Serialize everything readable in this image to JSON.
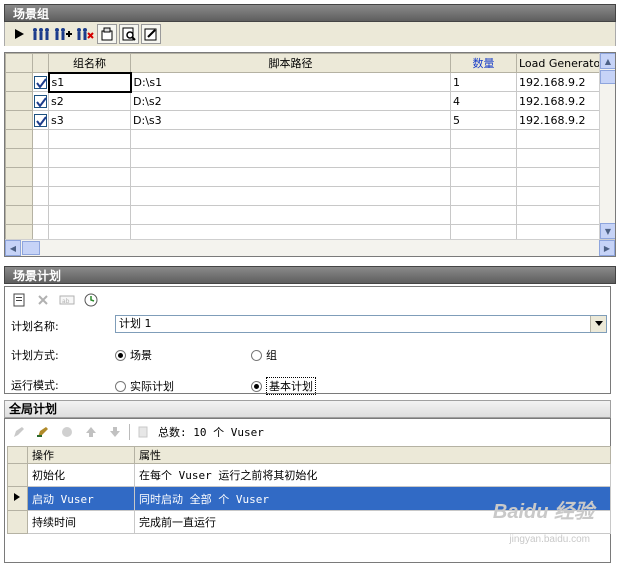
{
  "scenario_groups": {
    "title": "场景组",
    "toolbar": [
      "play-icon",
      "vusers-icon",
      "add-vusers-icon",
      "remove-vusers-icon",
      "details-icon",
      "view-script-icon",
      "runtime-settings-icon"
    ],
    "columns": [
      "组名称",
      "脚本路径",
      "数量",
      "Load Generator"
    ],
    "rows": [
      {
        "checked": true,
        "name": "s1",
        "path": "D:\\s1",
        "quantity": "1",
        "generator": "192.168.9.2"
      },
      {
        "checked": true,
        "name": "s2",
        "path": "D:\\s2",
        "quantity": "4",
        "generator": "192.168.9.2"
      },
      {
        "checked": true,
        "name": "s3",
        "path": "D:\\s3",
        "quantity": "5",
        "generator": "192.168.9.2"
      }
    ]
  },
  "scenario_schedule": {
    "title": "场景计划",
    "name_label": "计划名称:",
    "name_value": "计划 1",
    "method_label": "计划方式:",
    "method_options": [
      "场景",
      "组"
    ],
    "method_selected": "场景",
    "mode_label": "运行模式:",
    "mode_options": [
      "实际计划",
      "基本计划"
    ],
    "mode_selected": "基本计划"
  },
  "global_schedule": {
    "title": "全局计划",
    "total_text": "总数: 10 个 Vuser",
    "columns": [
      "操作",
      "属性"
    ],
    "rows": [
      {
        "action": "初始化",
        "property": "在每个 Vuser 运行之前将其初始化"
      },
      {
        "action": "启动 Vuser",
        "property": "同时启动 全部 个 Vuser",
        "selected": true
      },
      {
        "action": "持续时间",
        "property": "完成前一直运行"
      }
    ]
  },
  "watermark": {
    "brand": "Baidu 经验",
    "url": "jingyan.baidu.com"
  },
  "colors": {
    "selection": "#316ac5",
    "quantity_header": "#1a3fc9",
    "panel_title": "#6e6e6e"
  }
}
